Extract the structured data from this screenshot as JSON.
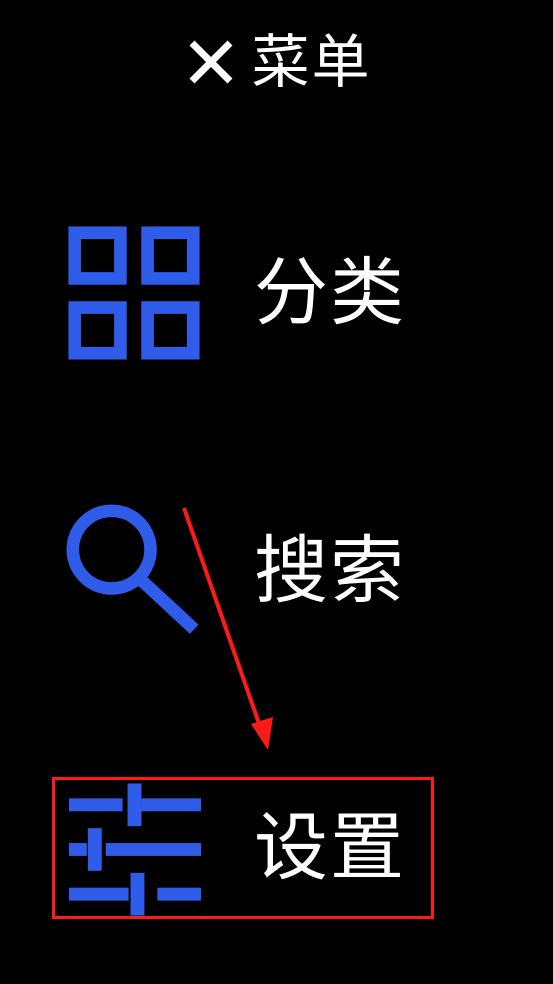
{
  "header": {
    "title": "菜单",
    "close_icon": "close-icon"
  },
  "menu": {
    "items": [
      {
        "label": "分类",
        "icon": "grid-icon"
      },
      {
        "label": "搜索",
        "icon": "search-icon"
      },
      {
        "label": "设置",
        "icon": "sliders-icon",
        "highlighted": true
      }
    ]
  },
  "colors": {
    "background": "#000000",
    "text": "#ffffff",
    "icon": "#2f5ce8",
    "annotation": "#ff1a1a"
  }
}
